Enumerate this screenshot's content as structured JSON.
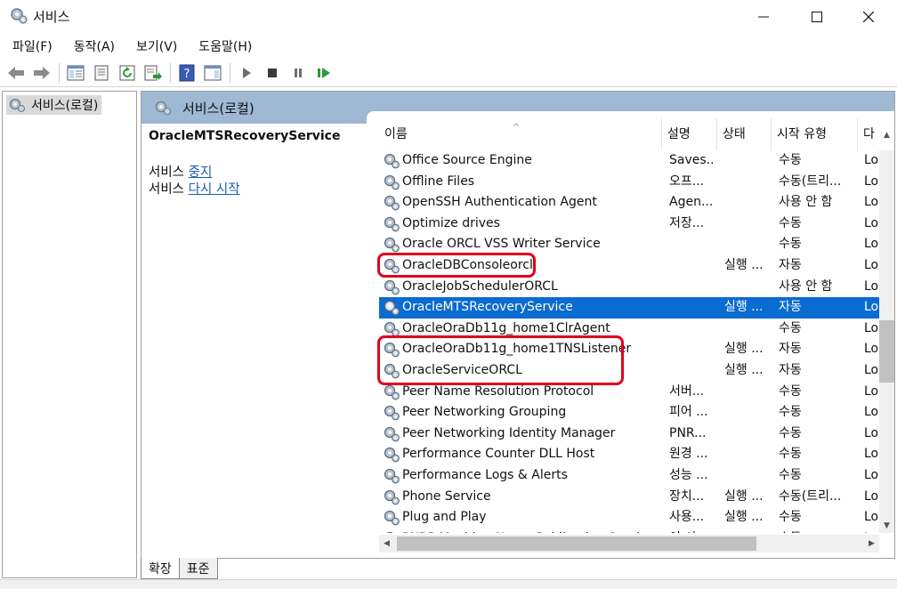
{
  "window": {
    "title": "서비스"
  },
  "menu": [
    "파일(F)",
    "동작(A)",
    "보기(V)",
    "도움말(H)"
  ],
  "tree": {
    "root_label": "서비스(로컬)"
  },
  "pane": {
    "header_title": "서비스(로컬)",
    "selected_service": "OracleMTSRecoveryService",
    "action1_prefix": "서비스",
    "action1_link": "중지",
    "action2_prefix": "서비스",
    "action2_link": "다시 시작"
  },
  "columns": [
    "이름",
    "설명",
    "상태",
    "시작 유형",
    "다"
  ],
  "rows": [
    {
      "name": "Office  Source Engine",
      "desc": "Saves...",
      "status": "",
      "start": "수동",
      "logon": "Lo"
    },
    {
      "name": "Offline Files",
      "desc": "오프...",
      "status": "",
      "start": "수동(트리...",
      "logon": "Lo"
    },
    {
      "name": "OpenSSH Authentication Agent",
      "desc": "Agen...",
      "status": "",
      "start": "사용 안 함",
      "logon": "Lo"
    },
    {
      "name": "Optimize drives",
      "desc": "저장...",
      "status": "",
      "start": "수동",
      "logon": "Lo"
    },
    {
      "name": "Oracle ORCL VSS Writer Service",
      "desc": "",
      "status": "",
      "start": "수동",
      "logon": "Lo"
    },
    {
      "name": "OracleDBConsoleorcl",
      "desc": "",
      "status": "실행 ...",
      "start": "자동",
      "logon": "Lo"
    },
    {
      "name": "OracleJobSchedulerORCL",
      "desc": "",
      "status": "",
      "start": "사용 안 함",
      "logon": "Lo"
    },
    {
      "name": "OracleMTSRecoveryService",
      "desc": "",
      "status": "실행 ...",
      "start": "자동",
      "logon": "Lo",
      "selected": true
    },
    {
      "name": "OracleOraDb11g_home1ClrAgent",
      "desc": "",
      "status": "",
      "start": "수동",
      "logon": "Lo"
    },
    {
      "name": "OracleOraDb11g_home1TNSListener",
      "desc": "",
      "status": "실행 ...",
      "start": "자동",
      "logon": "Lo"
    },
    {
      "name": "OracleServiceORCL",
      "desc": "",
      "status": "실행 ...",
      "start": "자동",
      "logon": "Lo"
    },
    {
      "name": "Peer Name Resolution Protocol",
      "desc": "서버...",
      "status": "",
      "start": "수동",
      "logon": "Lo"
    },
    {
      "name": "Peer Networking Grouping",
      "desc": "피어 ...",
      "status": "",
      "start": "수동",
      "logon": "Lo"
    },
    {
      "name": "Peer Networking Identity Manager",
      "desc": "PNR...",
      "status": "",
      "start": "수동",
      "logon": "Lo"
    },
    {
      "name": "Performance Counter DLL Host",
      "desc": "원경 ...",
      "status": "",
      "start": "수동",
      "logon": "Lo"
    },
    {
      "name": "Performance Logs & Alerts",
      "desc": "성능 ...",
      "status": "",
      "start": "수동",
      "logon": "Lo"
    },
    {
      "name": "Phone Service",
      "desc": "장치...",
      "status": "실행 ...",
      "start": "수동(트리...",
      "logon": "Lo"
    },
    {
      "name": "Plug and Play",
      "desc": "사용...",
      "status": "실행 ...",
      "start": "수동",
      "logon": "Lo"
    },
    {
      "name": "PNRP Machine Name Publication Service",
      "desc": "이 서...",
      "status": "",
      "start": "수동",
      "logon": "Lo"
    }
  ],
  "tabs": [
    "확장",
    "표준"
  ],
  "colors": {
    "selection": "#0a6bd0",
    "header_band": "#9fb9d4",
    "highlight": "#e0001b",
    "link": "#1a5fb4"
  }
}
